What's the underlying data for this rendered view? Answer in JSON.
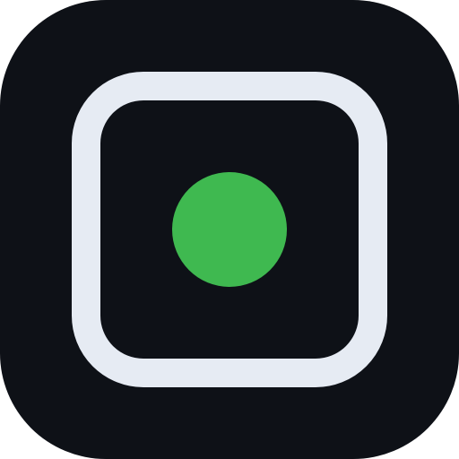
{
  "icon": {
    "name": "screen-record-icon",
    "colors": {
      "tile_background": "#0e1117",
      "frame_stroke": "#e6ebf3",
      "record_dot": "#3fb950"
    }
  }
}
